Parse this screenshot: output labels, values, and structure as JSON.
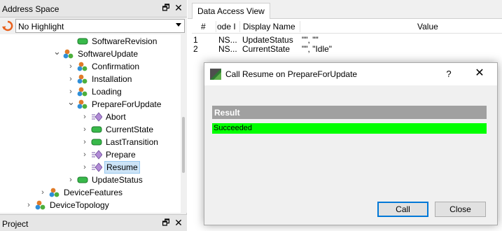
{
  "address_space": {
    "title": "Address Space",
    "dock_icon": "dock-window-icon",
    "close_icon": "close-icon",
    "highlight_select": {
      "value": "No Highlight"
    }
  },
  "tree": [
    {
      "label": "SoftwareRevision",
      "icon": "variable-icon",
      "expand": "none",
      "level": 3,
      "selected": false
    },
    {
      "label": "SoftwareUpdate",
      "icon": "object-icon",
      "expand": "expanded",
      "level": 2,
      "selected": false
    },
    {
      "label": "Confirmation",
      "icon": "object-icon",
      "expand": "collapsed",
      "level": 3,
      "selected": false
    },
    {
      "label": "Installation",
      "icon": "object-icon",
      "expand": "collapsed",
      "level": 3,
      "selected": false
    },
    {
      "label": "Loading",
      "icon": "object-icon",
      "expand": "collapsed",
      "level": 3,
      "selected": false
    },
    {
      "label": "PrepareForUpdate",
      "icon": "object-icon",
      "expand": "expanded",
      "level": 3,
      "selected": false
    },
    {
      "label": "Abort",
      "icon": "method-icon",
      "expand": "collapsed",
      "level": 4,
      "selected": false
    },
    {
      "label": "CurrentState",
      "icon": "variable-icon",
      "expand": "collapsed",
      "level": 4,
      "selected": false
    },
    {
      "label": "LastTransition",
      "icon": "variable-icon",
      "expand": "collapsed",
      "level": 4,
      "selected": false
    },
    {
      "label": "Prepare",
      "icon": "method-icon",
      "expand": "collapsed",
      "level": 4,
      "selected": false
    },
    {
      "label": "Resume",
      "icon": "method-icon",
      "expand": "collapsed",
      "level": 4,
      "selected": true
    },
    {
      "label": "UpdateStatus",
      "icon": "variable-icon",
      "expand": "collapsed",
      "level": 3,
      "selected": false
    },
    {
      "label": "DeviceFeatures",
      "icon": "object-icon",
      "expand": "collapsed",
      "level": 1,
      "selected": false
    },
    {
      "label": "DeviceTopology",
      "icon": "object-icon",
      "expand": "collapsed",
      "level": 0,
      "selected": false
    }
  ],
  "project_panel": {
    "title": "Project",
    "dock_icon": "dock-window-icon",
    "close_icon": "close-icon"
  },
  "data_access": {
    "tab_label": "Data Access View",
    "columns": [
      "#",
      "ode I",
      "Display Name",
      "Value"
    ],
    "rows": [
      {
        "num": "1",
        "node": "NS...",
        "display_name": "UpdateStatus",
        "value": "\"\", \"\""
      },
      {
        "num": "2",
        "node": "NS...",
        "display_name": "CurrentState",
        "value": "\"\", \"Idle\""
      }
    ]
  },
  "dialog": {
    "title": "Call Resume on PrepareForUpdate",
    "help_label": "?",
    "close_label": "✕",
    "result_header": "Result",
    "result_value": "Succeeded",
    "result_color": "#00ff00",
    "call_label": "Call",
    "close_button_label": "Close"
  }
}
